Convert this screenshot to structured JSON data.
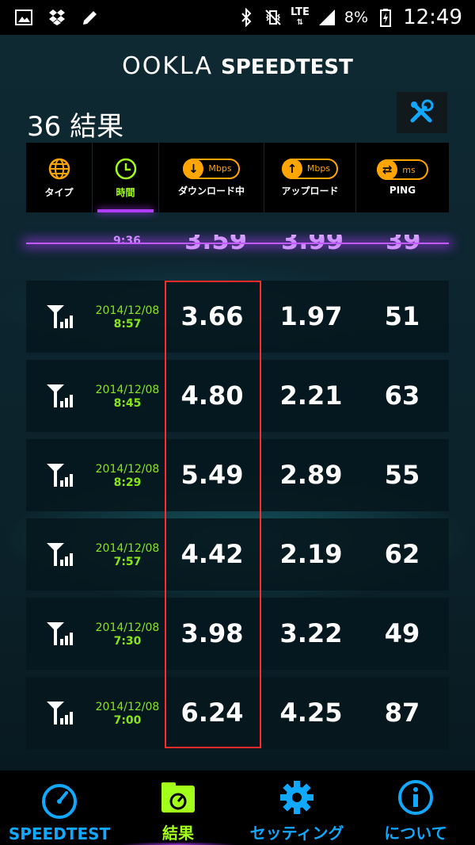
{
  "status_bar": {
    "battery_percent": "8%",
    "time": "12:49",
    "network": "LTE",
    "icons": [
      "image-icon",
      "dropbox-icon",
      "edit-icon",
      "bluetooth-icon",
      "vibrate-icon",
      "signal-icon",
      "battery-charging-icon"
    ]
  },
  "header": {
    "brand_ookla": "OOKLA",
    "brand_speedtest": "SPEEDTEST",
    "results_count": "36 結果",
    "tools_icon": "tools-icon"
  },
  "sort_tabs": [
    {
      "label": "タイプ",
      "icon": "globe-icon",
      "active": false
    },
    {
      "label": "時間",
      "icon": "clock-icon",
      "active": true
    },
    {
      "label": "ダウンロード中",
      "unit": "Mbps",
      "icon": "download-icon",
      "active": false
    },
    {
      "label": "アップロード",
      "unit": "Mbps",
      "icon": "upload-icon",
      "active": false
    },
    {
      "label": "PING",
      "unit": "ms",
      "icon": "ping-icon",
      "active": false
    }
  ],
  "partial_row": {
    "time": "9:36",
    "download": "3.59",
    "upload": "3.99",
    "ping": "39"
  },
  "results": [
    {
      "date": "2014/12/08",
      "time": "8:57",
      "download": "3.66",
      "upload": "1.97",
      "ping": "51"
    },
    {
      "date": "2014/12/08",
      "time": "8:45",
      "download": "4.80",
      "upload": "2.21",
      "ping": "63"
    },
    {
      "date": "2014/12/08",
      "time": "8:29",
      "download": "5.49",
      "upload": "2.89",
      "ping": "55"
    },
    {
      "date": "2014/12/08",
      "time": "7:57",
      "download": "4.42",
      "upload": "2.19",
      "ping": "62"
    },
    {
      "date": "2014/12/08",
      "time": "7:30",
      "download": "3.98",
      "upload": "3.22",
      "ping": "49"
    },
    {
      "date": "2014/12/08",
      "time": "7:00",
      "download": "6.24",
      "upload": "4.25",
      "ping": "87"
    }
  ],
  "bottom_nav": [
    {
      "label": "SPEEDTEST",
      "icon": "speedometer-icon",
      "active": false
    },
    {
      "label": "結果",
      "icon": "results-folder-icon",
      "active": true
    },
    {
      "label": "セッティング",
      "icon": "gear-icon",
      "active": false
    },
    {
      "label": "について",
      "icon": "info-icon",
      "active": false
    }
  ],
  "colors": {
    "accent_green": "#a3ff1a",
    "accent_blue": "#11a8ff",
    "accent_orange": "#ffa500",
    "accent_purple": "#b03cff",
    "highlight_red": "#ff2b2b"
  }
}
